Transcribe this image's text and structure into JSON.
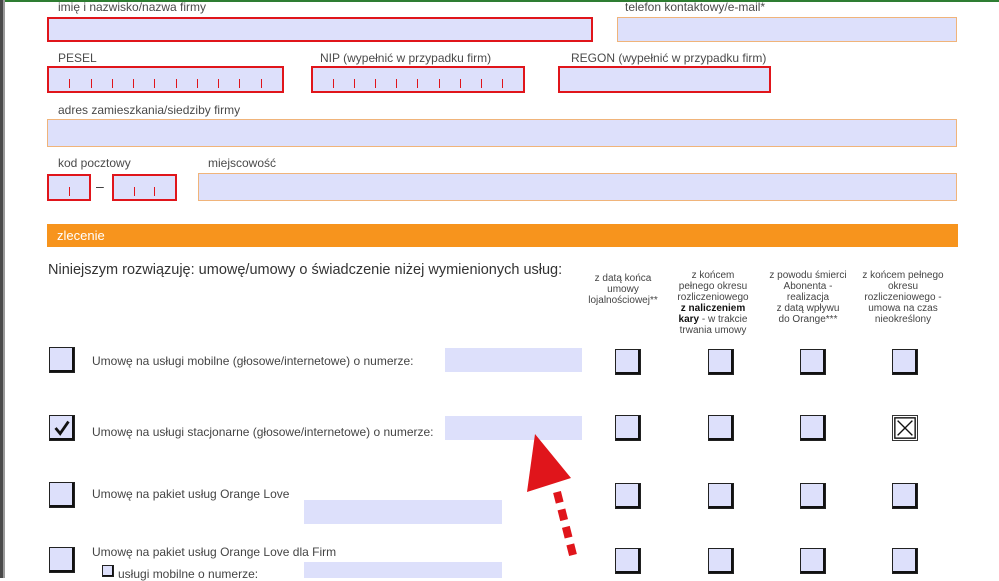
{
  "form": {
    "name_label": "imię i nazwisko/nazwa firmy",
    "contact_label": "telefon kontaktowy/e-mail*",
    "pesel_label": "PESEL",
    "nip_label": "NIP (wypełnić w przypadku firm)",
    "regon_label": "REGON (wypełnić w przypadku firm)",
    "address_label": "adres zamieszkania/siedziby firmy",
    "postal_label": "kod pocztowy",
    "postal_dash": "–",
    "city_label": "miejscowość"
  },
  "section": {
    "title": "zlecenie"
  },
  "intro": "Niniejszym rozwiązuję: umowę/umowy o świadczenie niżej wymienionych usług:",
  "columns": [
    {
      "l1": "z datą końca",
      "l2": "umowy",
      "l3": "lojalnościowej**",
      "l4": "",
      "l5": "",
      "l6": ""
    },
    {
      "l1": "z końcem",
      "l2": "pełnego okresu",
      "l3": "rozliczeniowego",
      "l4b": "z naliczeniem",
      "l5b": "kary",
      "l5": " - w trakcie",
      "l6": "trwania umowy"
    },
    {
      "l1": "z powodu śmierci",
      "l2": "Abonenta -",
      "l3": "realizacja",
      "l4": "z datą wpływu",
      "l5": "do Orange***",
      "l6": ""
    },
    {
      "l1": "z końcem pełnego",
      "l2": "okresu",
      "l3": "rozliczeniowego -",
      "l4": "umowa na czas",
      "l5": "nieokreślony",
      "l6": ""
    }
  ],
  "services": [
    {
      "label": "Umowę na usługi mobilne (głosowe/internetowe) o numerze:",
      "checked": false,
      "col_checked": [
        false,
        false,
        false,
        false
      ]
    },
    {
      "label": "Umowę na usługi stacjonarne (głosowe/internetowe) o numerze:",
      "checked": true,
      "col_checked": [
        false,
        false,
        false,
        true
      ]
    },
    {
      "label": "Umowę na pakiet usług Orange Love",
      "checked": false,
      "col_checked": [
        false,
        false,
        false,
        false
      ]
    },
    {
      "label": "Umowę na pakiet usług Orange Love dla Firm",
      "checked": false,
      "col_checked": [
        false,
        false,
        false,
        false
      ]
    }
  ],
  "sub_option": {
    "label": "usługi mobilne o numerze:"
  },
  "icons": {
    "check": "checkmark-icon",
    "x": "x-mark-icon",
    "arrow": "dotted-arrow-icon"
  },
  "colors": {
    "accent": "#f7941d",
    "field": "#dde0fb",
    "required": "#e0151b",
    "arrow": "#e0151b"
  }
}
